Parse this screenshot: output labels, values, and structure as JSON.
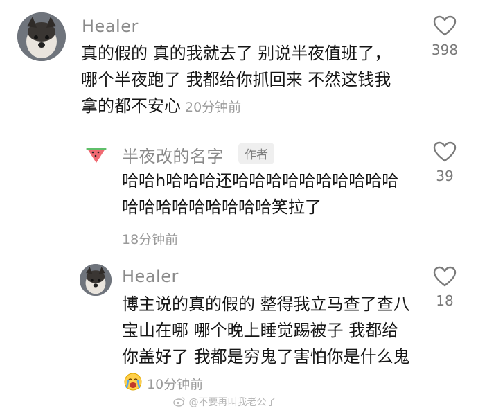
{
  "comments": [
    {
      "username": "Healer",
      "text": "真的假的  真的我就去了  别说半夜值班了，哪个半夜跑了 我都给你抓回来  不然这钱我拿的都不安心",
      "time": "20分钟前",
      "likes": "398"
    },
    {
      "username": "半夜改的名字",
      "tag": "作者",
      "text": "哈哈h哈哈哈还哈哈哈哈哈哈哈哈哈哈哈哈哈哈哈哈哈哈哈笑拉了",
      "time": "18分钟前",
      "likes": "39"
    },
    {
      "username": "Healer",
      "text": "博主说的真的假的  整得我立马查了查八宝山在哪    哪个晚上睡觉踢被子 我都给你盖好了  我都是穷鬼了害怕你是什么鬼",
      "time": "10分钟前",
      "likes": "18"
    }
  ],
  "watermark": "@不要再叫我老公了",
  "icons": {
    "like": "heart-outline-icon",
    "author_avatar": "watermelon-icon",
    "emoji": "crying-face-emoji",
    "watermark_logo": "weibo-logo-icon"
  },
  "colors": {
    "username": "#8a8a8a",
    "text": "#161616",
    "meta": "#9a9a9a",
    "tag_bg": "#efefef"
  }
}
